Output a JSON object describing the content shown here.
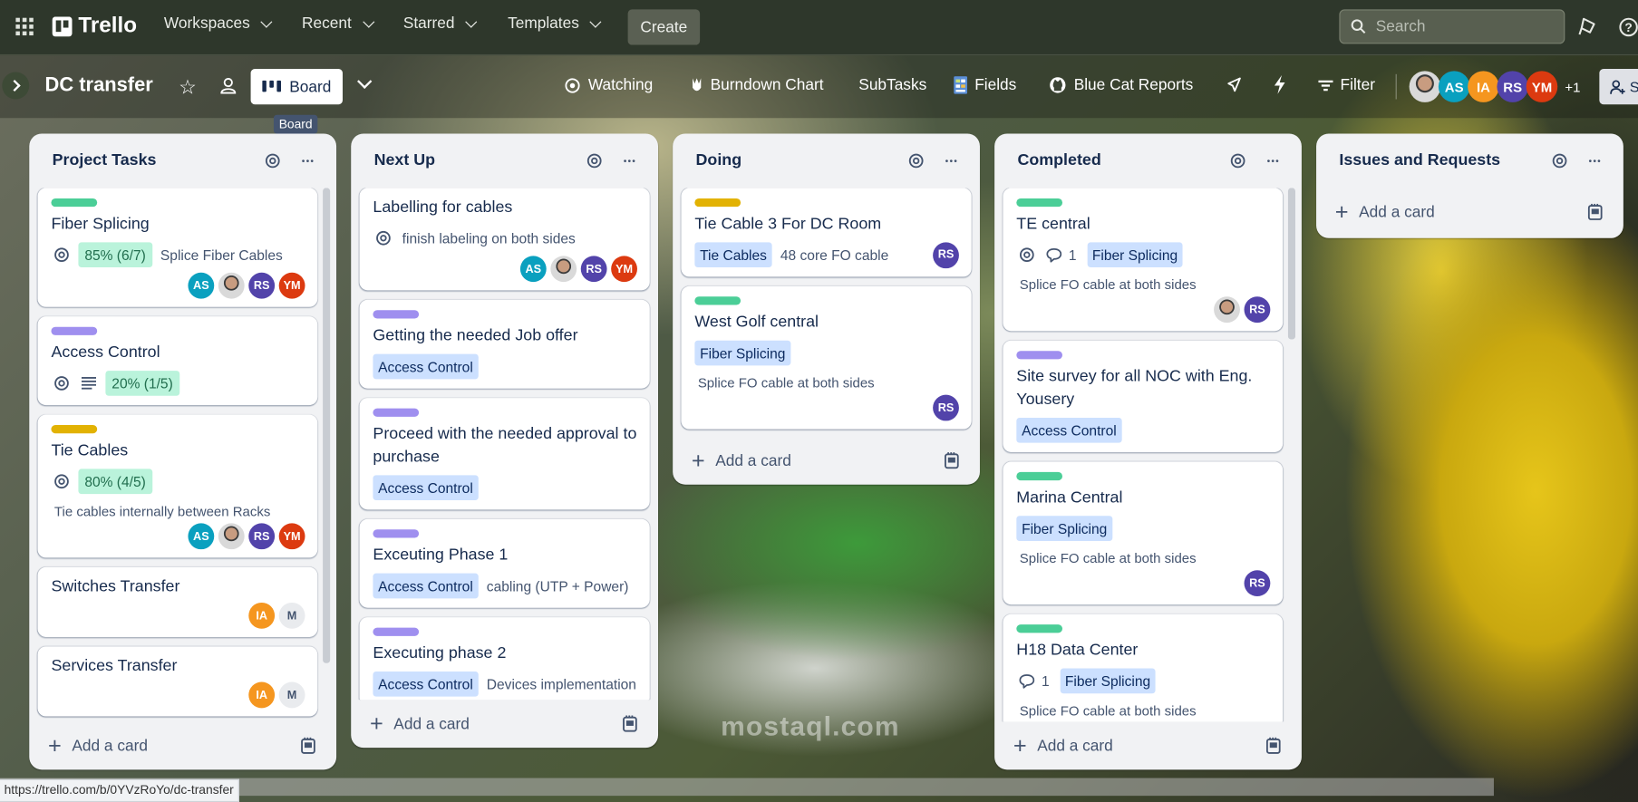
{
  "topnav": {
    "logo": "Trello",
    "menus": [
      "Workspaces",
      "Recent",
      "Starred",
      "Templates"
    ],
    "create_label": "Create",
    "search_placeholder": "Search"
  },
  "board": {
    "title": "DC transfer",
    "view_label": "Board",
    "tooltip": "Board",
    "actions": {
      "watching": "Watching",
      "burndown": "Burndown Chart",
      "subtasks": "SubTasks",
      "fields": "Fields",
      "bluecat": "Blue Cat Reports",
      "filter": "Filter"
    },
    "members": [
      {
        "initials": "",
        "color": "#cccccc",
        "photo": true
      },
      {
        "initials": "AS",
        "color": "#0aa0bf"
      },
      {
        "initials": "IA",
        "color": "#f5961f"
      },
      {
        "initials": "RS",
        "color": "#5243aa"
      },
      {
        "initials": "YM",
        "color": "#dc3a10"
      }
    ],
    "extra_members": "+1",
    "share_label": "S"
  },
  "add_card_label": "Add a card",
  "avatar_colors": {
    "AS": "#0aa0bf",
    "IA": "#f5961f",
    "RS": "#5243aa",
    "YM": "#dc3a10",
    "M": "#e9ebee"
  },
  "label_colors": {
    "green": "#4bce97",
    "purple": "#9f8fef",
    "yellow": "#e2b203"
  },
  "lists": [
    {
      "title": "Project Tasks",
      "cards": [
        {
          "label": "green",
          "title": "Fiber Splicing",
          "badges": [
            {
              "type": "watch"
            },
            {
              "type": "checklist",
              "text": "85% (6/7)"
            },
            {
              "type": "text",
              "text": "Splice Fiber Cables"
            }
          ],
          "members": [
            "AS",
            "photo",
            "RS",
            "YM"
          ]
        },
        {
          "label": "purple",
          "title": "Access Control",
          "badges": [
            {
              "type": "watch"
            },
            {
              "type": "desc"
            },
            {
              "type": "checklist",
              "text": "20% (1/5)"
            }
          ],
          "members": []
        },
        {
          "label": "yellow",
          "title": "Tie Cables",
          "badges": [
            {
              "type": "watch"
            },
            {
              "type": "checklist",
              "text": "80% (4/5)"
            }
          ],
          "note": "Tie cables internally between Racks",
          "members": [
            "AS",
            "photo",
            "RS",
            "YM"
          ]
        },
        {
          "title": "Switches Transfer",
          "badges": [],
          "members": [
            "IA",
            "M"
          ]
        },
        {
          "title": "Services Transfer",
          "badges": [],
          "members": [
            "IA",
            "M"
          ]
        }
      ]
    },
    {
      "title": "Next Up",
      "cards": [
        {
          "title": "Labelling for cables",
          "badges": [
            {
              "type": "watch"
            },
            {
              "type": "text",
              "text": "finish labeling on both sides"
            }
          ],
          "members": [
            "AS",
            "photo",
            "RS",
            "YM"
          ]
        },
        {
          "label": "purple",
          "title": "Getting the needed Job offer",
          "badges": [
            {
              "type": "chip",
              "text": "Access Control"
            }
          ],
          "members": []
        },
        {
          "label": "purple",
          "title": "Proceed with the needed approval to purchase",
          "badges": [
            {
              "type": "chip",
              "text": "Access Control"
            }
          ],
          "members": []
        },
        {
          "label": "purple",
          "title": "Exceuting Phase 1",
          "badges": [
            {
              "type": "chip",
              "text": "Access Control"
            },
            {
              "type": "text",
              "text": "cabling (UTP + Power)"
            }
          ],
          "members": []
        },
        {
          "label": "purple",
          "title": "Executing phase 2",
          "badges": [
            {
              "type": "chip",
              "text": "Access Control"
            },
            {
              "type": "text",
              "text": "Devices implementation"
            }
          ],
          "members": []
        }
      ]
    },
    {
      "title": "Doing",
      "cards": [
        {
          "label": "yellow",
          "title": "Tie Cable 3 For DC Room",
          "badges": [
            {
              "type": "chip",
              "text": "Tie Cables"
            },
            {
              "type": "text",
              "text": "48 core FO cable"
            }
          ],
          "members": [
            "RS"
          ],
          "members_inline": true
        },
        {
          "label": "green",
          "title": "West Golf central",
          "badges": [
            {
              "type": "chip",
              "text": "Fiber Splicing"
            }
          ],
          "note": "Splice FO cable at both sides",
          "members": [
            "RS"
          ]
        }
      ]
    },
    {
      "title": "Completed",
      "cards": [
        {
          "label": "green",
          "title": "TE central",
          "badges": [
            {
              "type": "watch"
            },
            {
              "type": "comment",
              "text": "1"
            },
            {
              "type": "chip",
              "text": "Fiber Splicing"
            }
          ],
          "note": "Splice FO cable at both sides",
          "members": [
            "photo",
            "RS"
          ]
        },
        {
          "label": "purple",
          "title": "Site survey for all NOC with Eng. Yousery",
          "badges": [
            {
              "type": "chip",
              "text": "Access Control"
            }
          ],
          "members": []
        },
        {
          "label": "green",
          "title": "Marina Central",
          "badges": [
            {
              "type": "chip",
              "text": "Fiber Splicing"
            }
          ],
          "note": "Splice FO cable at both sides",
          "members": [
            "RS"
          ]
        },
        {
          "label": "green",
          "title": "H18 Data Center",
          "badges": [
            {
              "type": "comment",
              "text": "1"
            },
            {
              "type": "chip",
              "text": "Fiber Splicing"
            }
          ],
          "note": "Splice FO cable at both sides",
          "members": []
        }
      ]
    },
    {
      "title": "Issues and Requests",
      "cards": []
    }
  ],
  "status_url": "https://trello.com/b/0YVzRoYo/dc-transfer",
  "watermark": "mostaql.com"
}
